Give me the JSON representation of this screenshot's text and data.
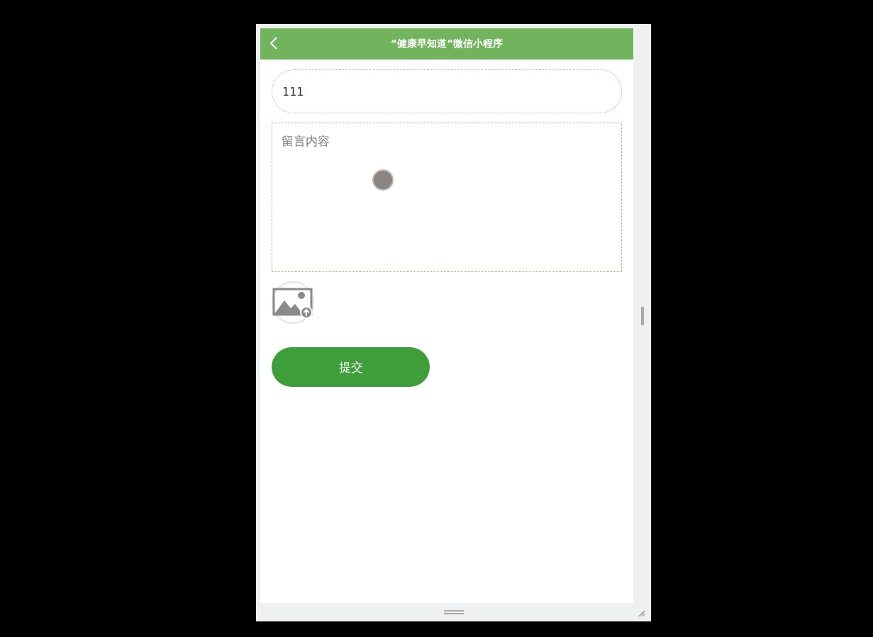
{
  "header": {
    "title": "“健康早知道”微信小程序"
  },
  "form": {
    "title_field": {
      "value": "111"
    },
    "content_field": {
      "placeholder": "留言内容"
    },
    "submit_button": {
      "label": "提交"
    }
  }
}
